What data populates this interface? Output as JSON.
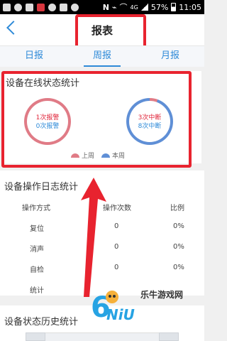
{
  "status_bar": {
    "battery": "57%",
    "time": "11:05",
    "network": "4G"
  },
  "header": {
    "title": "报表"
  },
  "tabs": [
    {
      "label": "日报",
      "active": false
    },
    {
      "label": "周报",
      "active": true
    },
    {
      "label": "月报",
      "active": false
    }
  ],
  "online_stats": {
    "title": "设备在线状态统计",
    "last_week": {
      "line1": "1次报警",
      "line2": "0次报警"
    },
    "this_week": {
      "line1": "3次中断",
      "line2": "8次中断"
    },
    "legend": {
      "last_week": "上周",
      "this_week": "本周"
    }
  },
  "operation_log": {
    "title": "设备操作日志统计",
    "headers": [
      "操作方式",
      "操作次数",
      "比例"
    ],
    "rows": [
      [
        "复位",
        "0",
        "0%"
      ],
      [
        "消声",
        "0",
        "0%"
      ],
      [
        "自检",
        "0",
        "0%"
      ],
      [
        "统计",
        "",
        ""
      ]
    ]
  },
  "history": {
    "title": "设备状态历史统计"
  },
  "watermark": {
    "text": "乐牛游戏网"
  },
  "colors": {
    "accent": "#2e8ad8",
    "highlight": "#e8232f",
    "last_week": "#e07b86",
    "this_week": "#5f8fd6"
  }
}
